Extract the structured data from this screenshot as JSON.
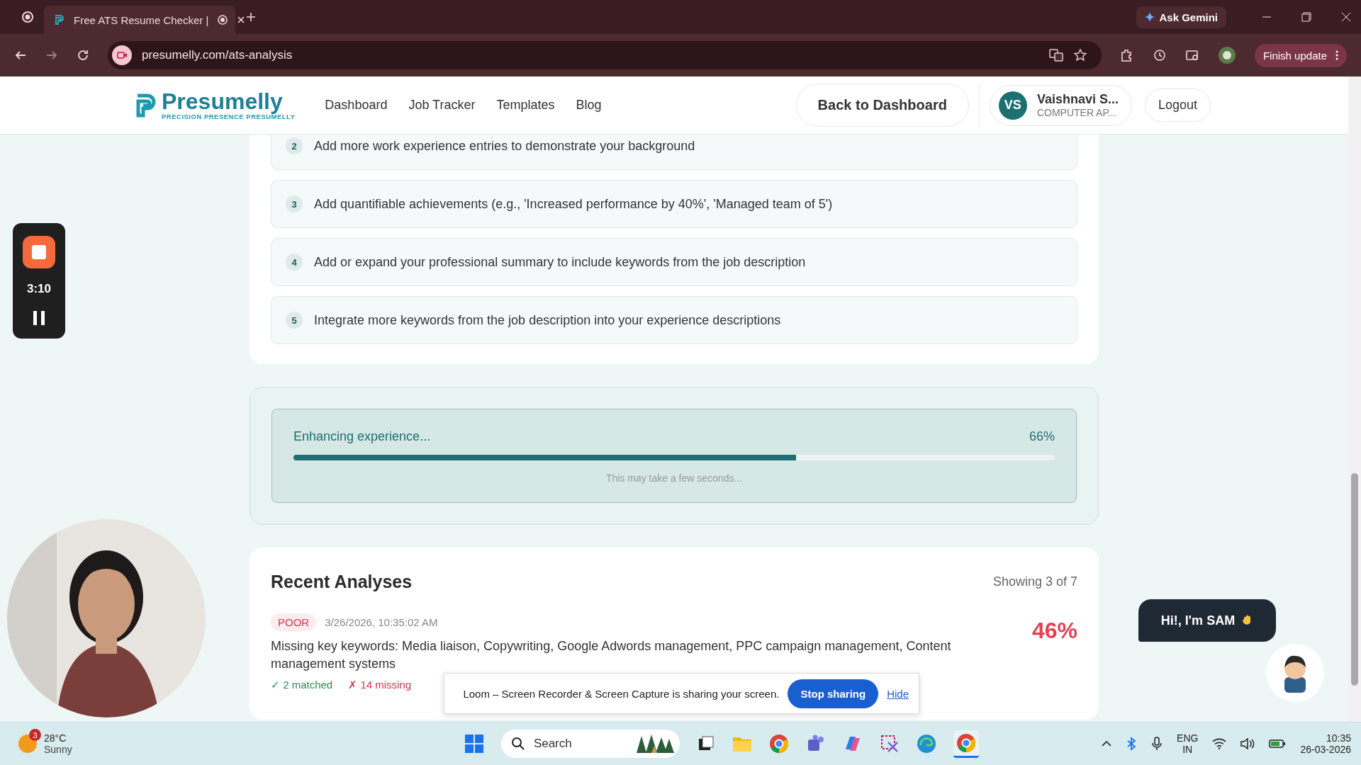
{
  "browser": {
    "tabs": [
      {
        "title": "Free ATS Resume Checker |",
        "selected": true
      }
    ],
    "url": "presumelly.com/ats-analysis",
    "ask_button": "Ask Gemini",
    "update_button": "Finish update"
  },
  "site": {
    "brand": {
      "name": "Presumelly",
      "tagline": "PRECISION PRESENCE PRESUMELLY"
    },
    "nav": [
      "Dashboard",
      "Job Tracker",
      "Templates",
      "Blog"
    ],
    "back_button": "Back to Dashboard",
    "user": {
      "initials": "VS",
      "name": "Vaishnavi S...",
      "role": "COMPUTER AP..."
    },
    "logout": "Logout"
  },
  "recommendations": [
    {
      "number": "2",
      "text": "Add more work experience entries to demonstrate your background"
    },
    {
      "number": "3",
      "text": "Add quantifiable achievements (e.g., 'Increased performance by 40%', 'Managed team of 5')"
    },
    {
      "number": "4",
      "text": "Add or expand your professional summary to include keywords from the job description"
    },
    {
      "number": "5",
      "text": "Integrate more keywords from the job description into your experience descriptions"
    }
  ],
  "progress": {
    "label": "Enhancing experience...",
    "percent": "66%",
    "level": 0.66,
    "note": "This may take a few seconds..."
  },
  "recent": {
    "title": "Recent Analyses",
    "count": "Showing 3 of 7",
    "entries": [
      {
        "rating": "POOR",
        "date": "3/26/2026, 10:35:02 AM",
        "score": "46%",
        "text": "Missing key keywords: Media liaison, Copywriting, Google Adwords management, PPC campaign management, Content management systems",
        "matched": "✓ 2 matched",
        "missing": "✗ 14 missing"
      }
    ]
  },
  "recorder": {
    "time": "3:10"
  },
  "chat": {
    "greeting": "Hi!, I'm SAM"
  },
  "share_bar": {
    "message": "Loom – Screen Recorder & Screen Capture is sharing your screen.",
    "stop_button": "Stop sharing",
    "hide_link": "Hide"
  },
  "taskbar": {
    "weather": {
      "badge": "3",
      "temp": "28°C",
      "condition": "Sunny"
    },
    "search": "Search",
    "language": [
      "ENG",
      "IN"
    ],
    "time": "10:35",
    "date": "26-03-2026"
  }
}
